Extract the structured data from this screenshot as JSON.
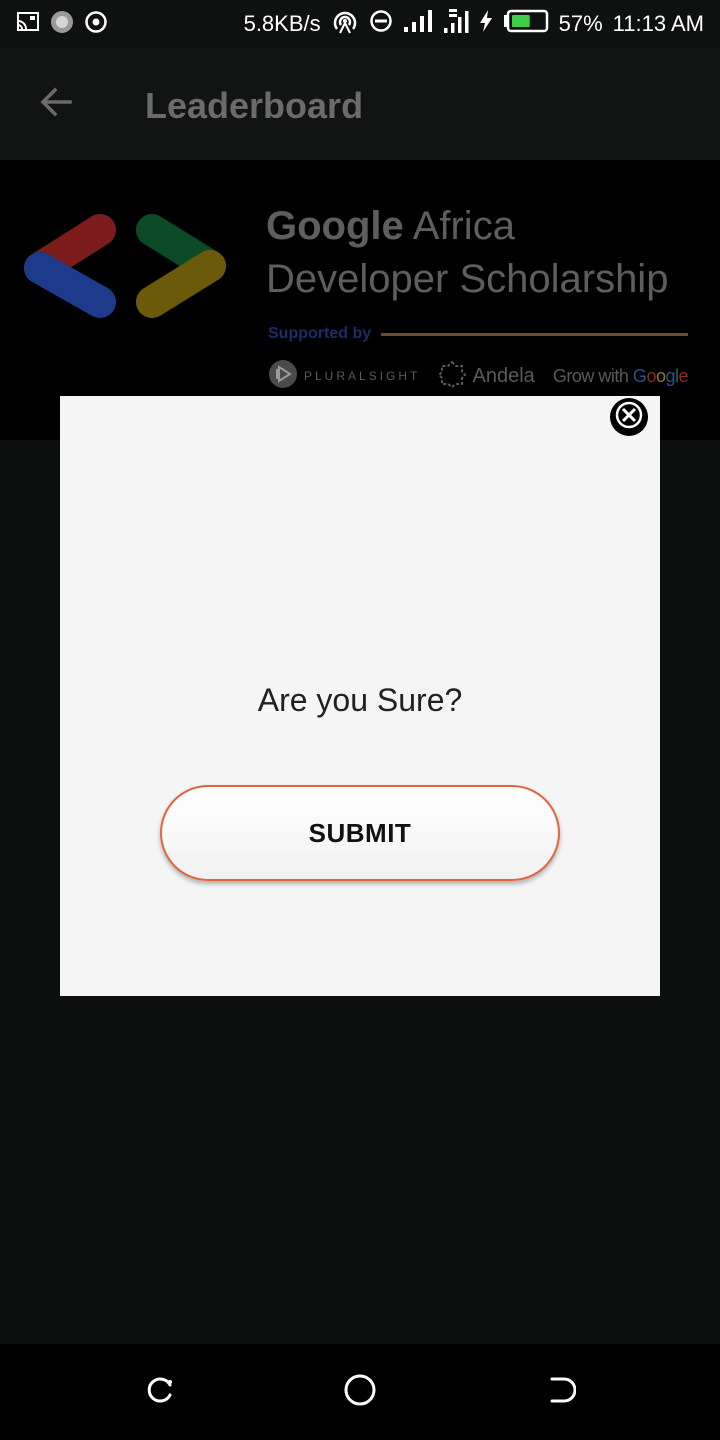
{
  "status_bar": {
    "network_speed": "5.8KB/s",
    "battery_percent": "57%",
    "time": "11:13 AM",
    "battery_level": 0.57,
    "battery_color": "#3ecf4a",
    "icons": [
      "cast-icon",
      "app-notification-icon",
      "target-icon",
      "hotspot-icon",
      "do-not-disturb-icon",
      "signal-icon",
      "data-signal-icon",
      "charging-icon",
      "battery-icon"
    ]
  },
  "app_bar": {
    "title": "Leaderboard",
    "back_icon": "arrow-left-icon"
  },
  "banner": {
    "title_bold": "Google",
    "title_rest": " Africa",
    "title_line2": "Developer Scholarship",
    "supported_by": "Supported by",
    "sponsors": {
      "pluralsight": "PLURALSIGHT",
      "andela": "Andela",
      "grow_with_prefix": "Grow with ",
      "google_letters": [
        "G",
        "o",
        "o",
        "g",
        "l",
        "e"
      ],
      "google_colors": [
        "#2a4f8f",
        "#8f2a22",
        "#8f7a1c",
        "#2a4f8f",
        "#2b6b3a",
        "#8f2a22"
      ]
    },
    "logo_colors": {
      "red": "#7d1c1c",
      "blue": "#1e3a8a",
      "green": "#0c4a26",
      "yellow": "#6b5a0a"
    }
  },
  "dialog": {
    "question": "Are you Sure?",
    "submit_label": "SUBMIT",
    "submit_border_color": "#e0643c",
    "close_icon": "close-circle-icon"
  },
  "nav_bar": {
    "icons": [
      "recent-apps-icon",
      "home-icon",
      "back-icon"
    ]
  }
}
